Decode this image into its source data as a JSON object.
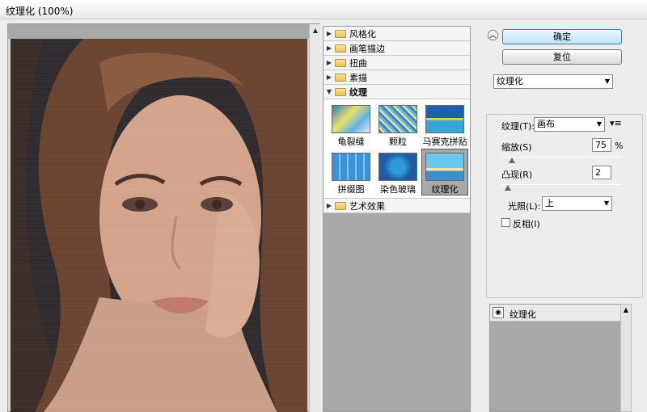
{
  "window": {
    "title": "纹理化 (100%)"
  },
  "filter_gallery": {
    "categories_before": [
      {
        "label": "风格化"
      },
      {
        "label": "画笔描边"
      },
      {
        "label": "扭曲"
      },
      {
        "label": "素描"
      }
    ],
    "open_category": {
      "label": "纹理"
    },
    "thumbnails": [
      {
        "label": "龟裂缝"
      },
      {
        "label": "颗粒"
      },
      {
        "label": "马赛克拼贴"
      },
      {
        "label": "拼缀图"
      },
      {
        "label": "染色玻璃"
      },
      {
        "label": "纹理化",
        "selected": true
      }
    ],
    "categories_after": [
      {
        "label": "艺术效果"
      }
    ]
  },
  "buttons": {
    "ok": "确定",
    "reset": "复位"
  },
  "filter_select": {
    "value": "纹理化"
  },
  "settings": {
    "texture_label": "纹理(T):",
    "texture_value": "画布",
    "scaling_label": "缩放(S)",
    "scaling_value": "75",
    "scaling_unit": "%",
    "relief_label": "凸现(R)",
    "relief_value": "2",
    "light_label": "光照(L):",
    "light_value": "上",
    "invert_label": "反相(I)",
    "invert_checked": false
  },
  "layers": {
    "items": [
      {
        "label": "纹理化"
      }
    ]
  },
  "icons": {
    "collapse": "double-chevron-up-icon",
    "eye": "eye-icon",
    "folder": "folder-icon",
    "menu": "panel-menu-icon"
  }
}
